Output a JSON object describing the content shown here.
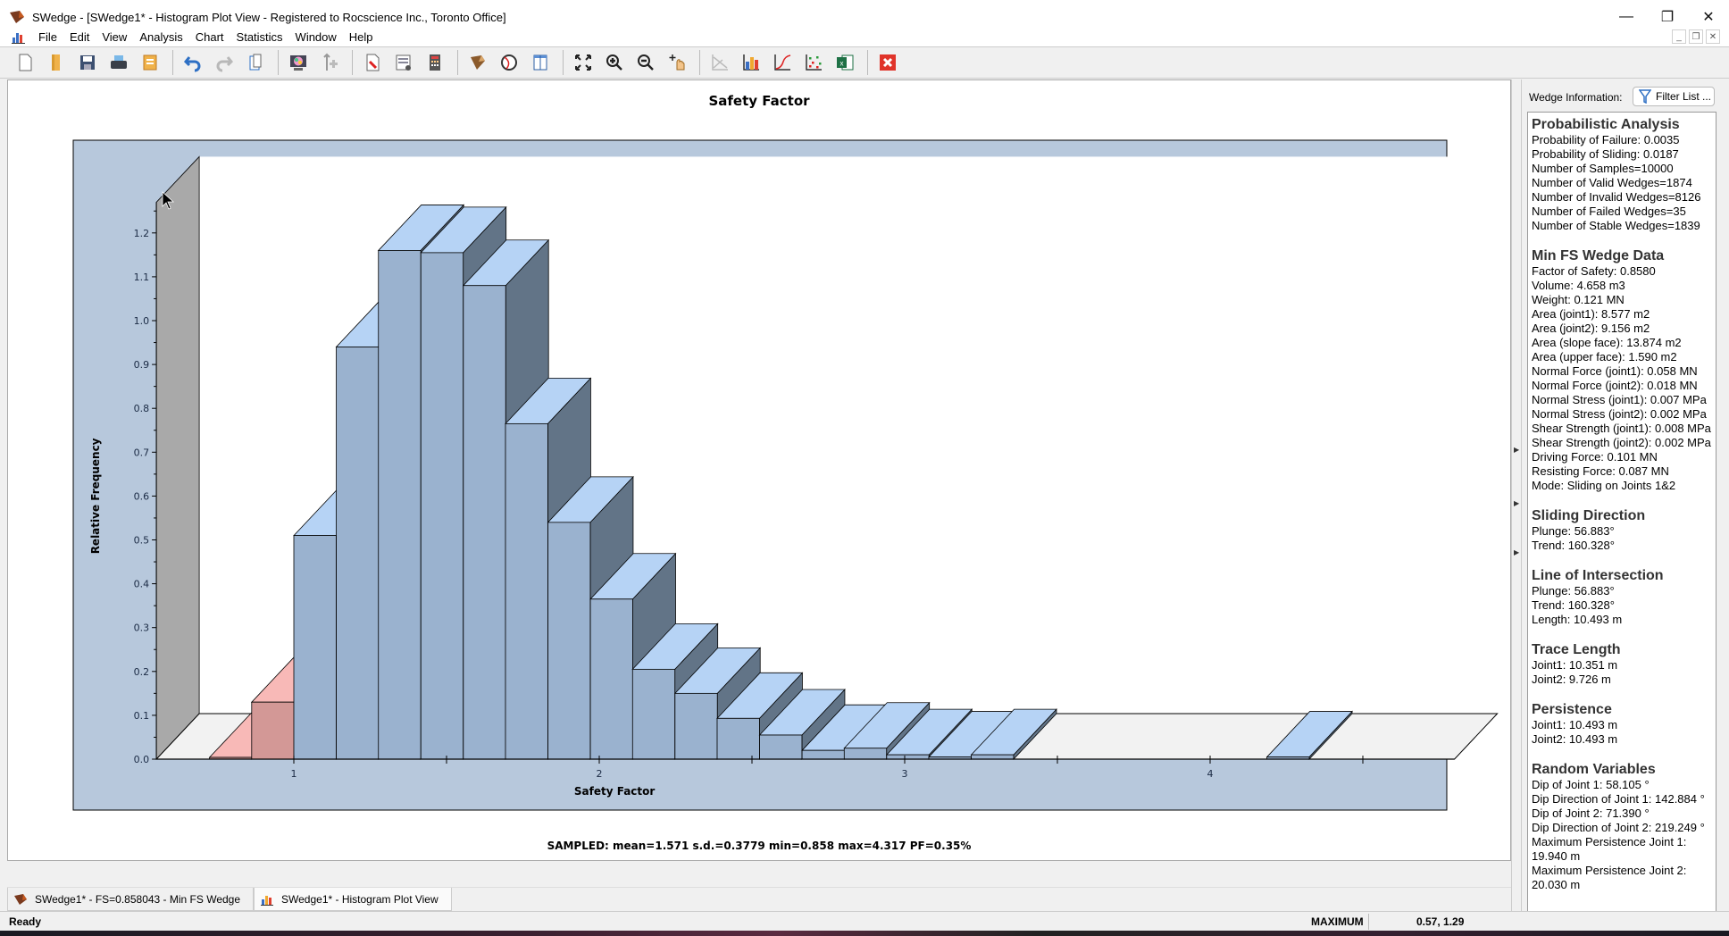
{
  "window": {
    "title": "SWedge - [SWedge1* - Histogram Plot View - Registered to Rocscience Inc., Toronto Office]",
    "controls": [
      "minimize-icon",
      "restore-icon",
      "close-icon"
    ]
  },
  "menu": {
    "items": [
      "File",
      "Edit",
      "View",
      "Analysis",
      "Chart",
      "Statistics",
      "Window",
      "Help"
    ]
  },
  "toolbar": {
    "buttons": [
      "new-file-icon",
      "open-folder-icon",
      "save-icon",
      "print-icon",
      "export-icon",
      "undo-icon",
      "redo-icon",
      "copy-icon",
      "render-icon",
      "add-joint-icon",
      "edit-input-icon",
      "project-settings-icon",
      "calculator-icon",
      "wedge-view-icon",
      "stereonet-icon",
      "columns-icon",
      "zoom-extents-icon",
      "zoom-in-icon",
      "zoom-out-icon",
      "pan-icon",
      "axes-icon",
      "histogram-icon",
      "cumulative-icon",
      "scatter-icon",
      "excel-icon",
      "close-view-icon"
    ]
  },
  "chart_data": {
    "type": "bar",
    "title": "Safety Factor",
    "xlabel": "Safety Factor",
    "ylabel": "Relative Frequency",
    "xlim": [
      0.55,
      4.8
    ],
    "ylim": [
      0.0,
      1.27
    ],
    "xticks": [
      "1",
      "2",
      "3",
      "4"
    ],
    "xtick_values": [
      1,
      2,
      3,
      4
    ],
    "yticks": [
      "0.0",
      "0.1",
      "0.2",
      "0.3",
      "0.4",
      "0.5",
      "0.6",
      "0.7",
      "0.8",
      "0.9",
      "1.0",
      "1.1",
      "1.2"
    ],
    "grid": false,
    "style": "3d",
    "bin_width": 0.1386,
    "bins": [
      {
        "x0": 0.724,
        "value": 0.004,
        "failed": true
      },
      {
        "x0": 0.862,
        "value": 0.13,
        "failed": true
      },
      {
        "x0": 1.0,
        "value": 0.51,
        "failed": false
      },
      {
        "x0": 1.139,
        "value": 0.94,
        "failed": false
      },
      {
        "x0": 1.277,
        "value": 1.16,
        "failed": false
      },
      {
        "x0": 1.416,
        "value": 1.155,
        "failed": false
      },
      {
        "x0": 1.555,
        "value": 1.08,
        "failed": false
      },
      {
        "x0": 1.693,
        "value": 0.765,
        "failed": false
      },
      {
        "x0": 1.832,
        "value": 0.54,
        "failed": false
      },
      {
        "x0": 1.971,
        "value": 0.365,
        "failed": false
      },
      {
        "x0": 2.109,
        "value": 0.205,
        "failed": false
      },
      {
        "x0": 2.248,
        "value": 0.15,
        "failed": false
      },
      {
        "x0": 2.386,
        "value": 0.093,
        "failed": false
      },
      {
        "x0": 2.525,
        "value": 0.055,
        "failed": false
      },
      {
        "x0": 2.664,
        "value": 0.02,
        "failed": false
      },
      {
        "x0": 2.802,
        "value": 0.025,
        "failed": false
      },
      {
        "x0": 2.941,
        "value": 0.01,
        "failed": false
      },
      {
        "x0": 3.079,
        "value": 0.005,
        "failed": false
      },
      {
        "x0": 3.218,
        "value": 0.01,
        "failed": false
      },
      {
        "x0": 4.186,
        "value": 0.005,
        "failed": false
      }
    ],
    "colors": {
      "safe_front": "#9ab2cf",
      "safe_top": "#b6d3f5",
      "safe_side": "#627487",
      "failed_front": "#d39896",
      "failed_top": "#f8b9b7",
      "frame_bg": "#b7c8dc",
      "wall": "#a9a9a9",
      "floor": "#f2f2f2"
    },
    "summary": "SAMPLED: mean=1.571 s.d.=0.3779 min=0.858 max=4.317 PF=0.35%"
  },
  "right_panel": {
    "header": "Wedge Information:",
    "filter_button": "Filter List ...",
    "sections": [
      {
        "title": "Probabilistic Analysis",
        "lines": [
          "Probability of Failure: 0.0035",
          "Probability of Sliding: 0.0187",
          "Number of Samples=10000",
          "Number of Valid Wedges=1874",
          "Number of Invalid Wedges=8126",
          "Number of Failed Wedges=35",
          "Number of Stable Wedges=1839"
        ]
      },
      {
        "title": "Min FS Wedge Data",
        "lines": [
          "Factor of Safety: 0.8580",
          "Volume: 4.658 m3",
          "Weight: 0.121 MN",
          "Area (joint1): 8.577 m2",
          "Area (joint2): 9.156 m2",
          "Area (slope face): 13.874 m2",
          "Area (upper face): 1.590 m2",
          "Normal Force (joint1): 0.058 MN",
          "Normal Force (joint2): 0.018 MN",
          "Normal Stress (joint1): 0.007 MPa",
          "Normal Stress (joint2): 0.002 MPa",
          "Shear Strength (joint1): 0.008 MPa",
          "Shear Strength (joint2): 0.002 MPa",
          "Driving Force: 0.101 MN",
          "Resisting Force: 0.087 MN",
          "Mode: Sliding on Joints 1&2"
        ]
      },
      {
        "title": "Sliding Direction",
        "lines": [
          "Plunge: 56.883°",
          "Trend: 160.328°"
        ]
      },
      {
        "title": "Line of Intersection",
        "lines": [
          "Plunge: 56.883°",
          "Trend: 160.328°",
          "Length: 10.493 m"
        ]
      },
      {
        "title": "Trace Length",
        "lines": [
          "Joint1: 10.351 m",
          "Joint2: 9.726 m"
        ]
      },
      {
        "title": "Persistence",
        "lines": [
          "Joint1: 10.493 m",
          "Joint2: 10.493 m"
        ]
      },
      {
        "title": "Random Variables",
        "lines": [
          "Dip of Joint 1: 58.105 °",
          "Dip Direction of Joint 1: 142.884 °",
          "Dip of Joint 2: 71.390 °",
          "Dip Direction of Joint 2: 219.249 °",
          "Maximum Persistence Joint 1:",
          "19.940 m",
          "Maximum Persistence Joint 2:",
          "20.030 m"
        ]
      }
    ]
  },
  "tabs": [
    {
      "label": "SWedge1* - FS=0.858043 - Min FS Wedge",
      "icon": "wedge-icon",
      "active": false
    },
    {
      "label": "SWedge1* - Histogram Plot View",
      "icon": "histogram-icon",
      "active": true
    }
  ],
  "status": {
    "ready": "Ready",
    "mode": "MAXIMUM",
    "coords": "0.57, 1.29"
  }
}
